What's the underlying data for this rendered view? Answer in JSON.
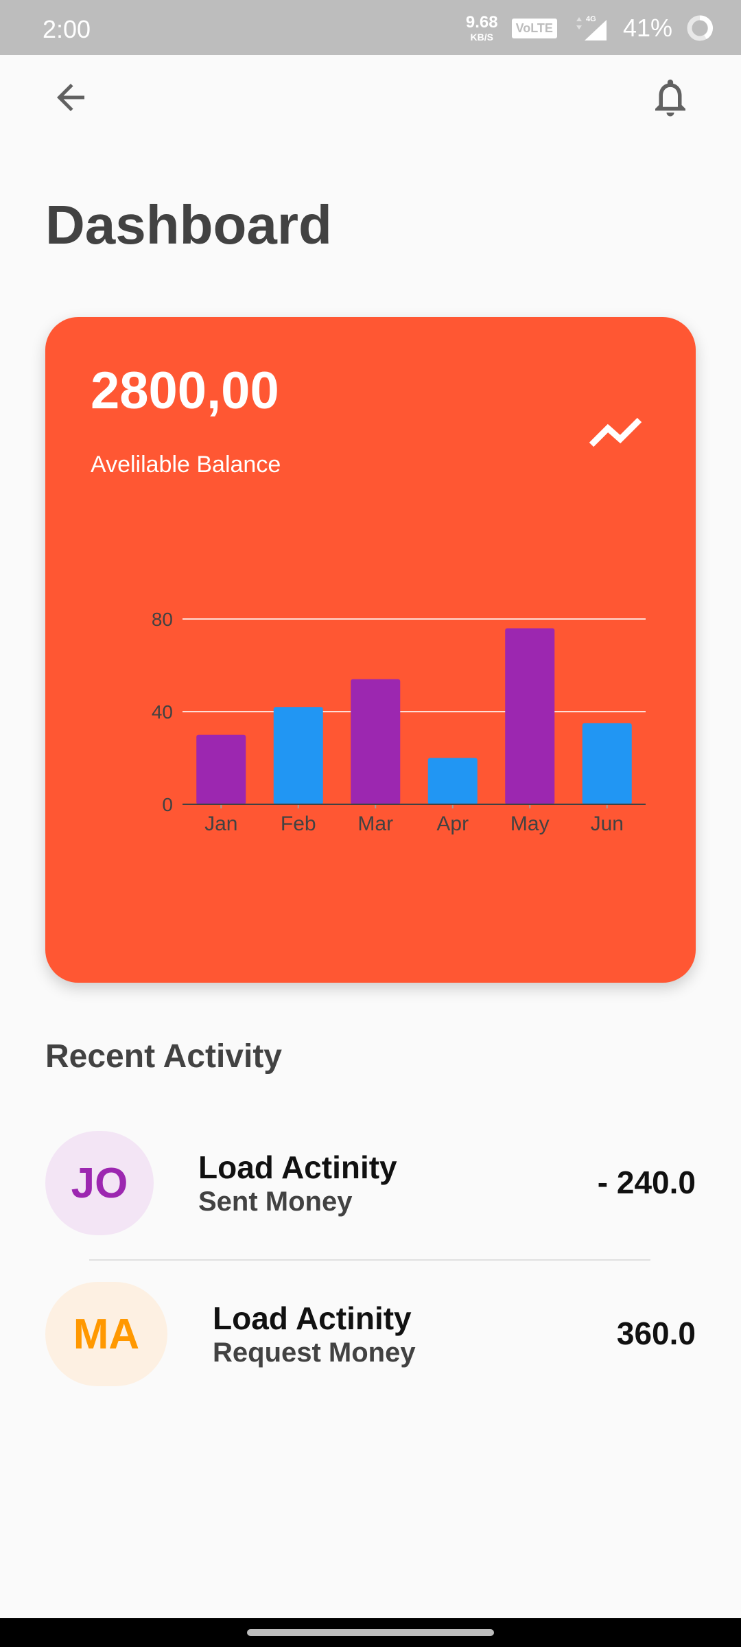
{
  "status_bar": {
    "time": "2:00",
    "net_speed": "9.68",
    "net_unit": "KB/S",
    "volte": "VoLTE",
    "network": "4G",
    "battery": "41%"
  },
  "header": {
    "back_icon": "arrow-left-icon",
    "bell_icon": "bell-icon",
    "title": "Dashboard"
  },
  "balance_card": {
    "amount": "2800,00",
    "label": "Avelilable Balance",
    "trend_icon": "trending-up-icon",
    "background_color": "#ff5733"
  },
  "chart_data": {
    "type": "bar",
    "categories": [
      "Jan",
      "Feb",
      "Mar",
      "Apr",
      "May",
      "Jun"
    ],
    "values": [
      30,
      42,
      54,
      20,
      76,
      35
    ],
    "colors": [
      "#9c27b0",
      "#2196f3",
      "#9c27b0",
      "#2196f3",
      "#9c27b0",
      "#2196f3"
    ],
    "yticks": [
      0,
      40,
      80
    ],
    "ylim": [
      0,
      80
    ],
    "grid": true
  },
  "recent_activity": {
    "title": "Recent Activity",
    "items": [
      {
        "initials": "JO",
        "title": "Load Actinity",
        "subtitle": "Sent Money",
        "amount": "- 240.0",
        "avatar_bg": "#f3e5f5",
        "avatar_fg": "#9c27b0"
      },
      {
        "initials": "MA",
        "title": "Load Actinity",
        "subtitle": "Request Money",
        "amount": "360.0",
        "avatar_bg": "#fdf0e2",
        "avatar_fg": "#ff9800"
      }
    ]
  }
}
